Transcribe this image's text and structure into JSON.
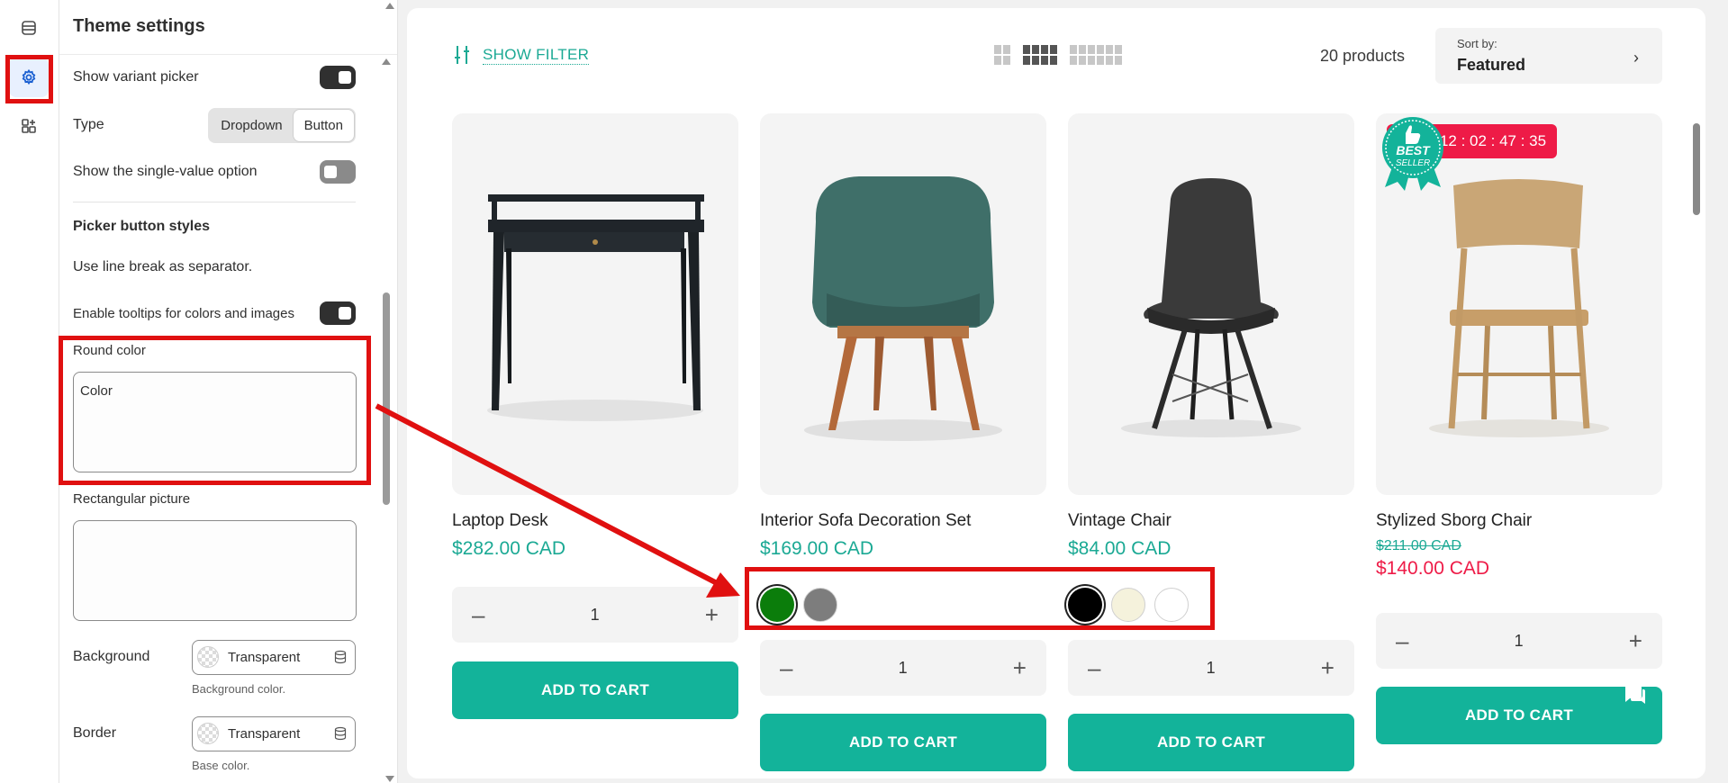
{
  "panel": {
    "title": "Theme settings",
    "show_variant_picker": "Show variant picker",
    "type_label": "Type",
    "type_options": [
      "Dropdown",
      "Button"
    ],
    "single_value": "Show the single-value option",
    "picker_styles": "Picker button styles",
    "line_break_note": "Use line break as separator.",
    "tooltips": "Enable tooltips for colors and images",
    "round_color_label": "Round color",
    "round_color_value": "Color",
    "rect_picture_label": "Rectangular picture",
    "rect_picture_value": "",
    "background_label": "Background",
    "background_value": "Transparent",
    "background_help": "Background color.",
    "border_label": "Border",
    "border_value": "Transparent",
    "border_help": "Base color."
  },
  "toolbar": {
    "filter_label": "SHOW FILTER",
    "product_count": "20 products",
    "sort_label": "Sort by:",
    "sort_value": "Featured"
  },
  "products": [
    {
      "name": "Laptop Desk",
      "price": "$282.00 CAD",
      "qty": "1",
      "cta": "ADD TO CART"
    },
    {
      "name": "Interior Sofa Decoration Set",
      "price": "$169.00 CAD",
      "qty": "1",
      "cta": "ADD TO CART",
      "swatches": [
        "#0b7d0b",
        "#7d7d7d"
      ]
    },
    {
      "name": "Vintage Chair",
      "price": "$84.00 CAD",
      "qty": "1",
      "cta": "ADD TO CART",
      "swatches": [
        "#000000",
        "#f5f2dc",
        "#ffffff"
      ]
    },
    {
      "name": "Stylized Sborg Chair",
      "old_price": "$211.00 CAD",
      "price": "$140.00 CAD",
      "qty": "1",
      "cta": "ADD TO CART",
      "sale_badge": "Sale   112 : 02 : 47 : 35",
      "best_seller": [
        "BEST",
        "SELLER"
      ]
    }
  ],
  "colors": {
    "accent": "#13b39a",
    "sale": "#ee1b47",
    "highlight": "#e01010"
  }
}
